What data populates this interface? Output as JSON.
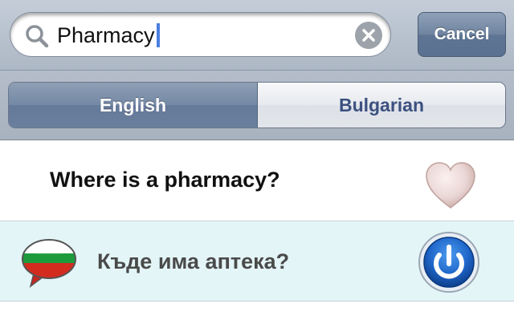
{
  "search": {
    "query": "Pharmacy",
    "cancel_label": "Cancel"
  },
  "segments": {
    "english_label": "English",
    "bulgarian_label": "Bulgarian",
    "selected": "English"
  },
  "rows": {
    "english_phrase": "Where is a pharmacy?",
    "bulgarian_phrase": "Къде има аптека?"
  },
  "icons": {
    "search": "search-icon",
    "clear": "clear-icon",
    "favorite": "heart-icon",
    "flag": "bulgarian-flag-bubble-icon",
    "play": "power-play-icon"
  },
  "colors": {
    "selected_segment": "#6a7e9d",
    "cancel_button": "#5e7594",
    "bulgarian_row_bg": "#e4f5f7",
    "caret": "#4a7fe0"
  }
}
